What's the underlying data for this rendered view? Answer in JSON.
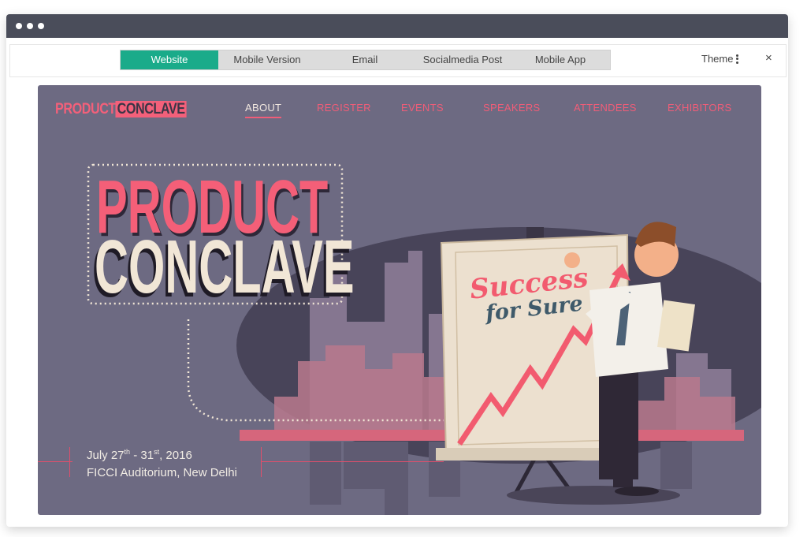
{
  "window": {
    "tabs": [
      {
        "label": "Website",
        "active": true
      },
      {
        "label": "Mobile Version",
        "active": false
      },
      {
        "label": "Email",
        "active": false
      },
      {
        "label": "Socialmedia Post",
        "active": false
      },
      {
        "label": "Mobile App",
        "active": false
      }
    ],
    "theme_label": "Theme",
    "close_glyph": "×"
  },
  "site": {
    "logo": {
      "part1": "PRODUCT",
      "part2": "CONCLAVE"
    },
    "nav": [
      "ABOUT",
      "REGISTER",
      "EVENTS",
      "SPEAKERS",
      "ATTENDEES",
      "EXHIBITORS"
    ],
    "headline": {
      "line1": "PRODUCT",
      "line2": "CONCLAVE"
    },
    "board_text": {
      "line1": "Success",
      "line2": "for Sure"
    },
    "event": {
      "date_part1": "July 27",
      "date_sup1": "th",
      "date_part2": " - 31",
      "date_sup2": "st",
      "date_part3": ", 2016",
      "venue": "FICCI Auditorium, New Delhi"
    }
  },
  "colors": {
    "accent": "#1aab8a",
    "brand_pink": "#f45f78",
    "background": "#6d6a82",
    "cream": "#f1e6d6"
  },
  "icons": [
    "menu-dots-icon",
    "close-icon"
  ]
}
